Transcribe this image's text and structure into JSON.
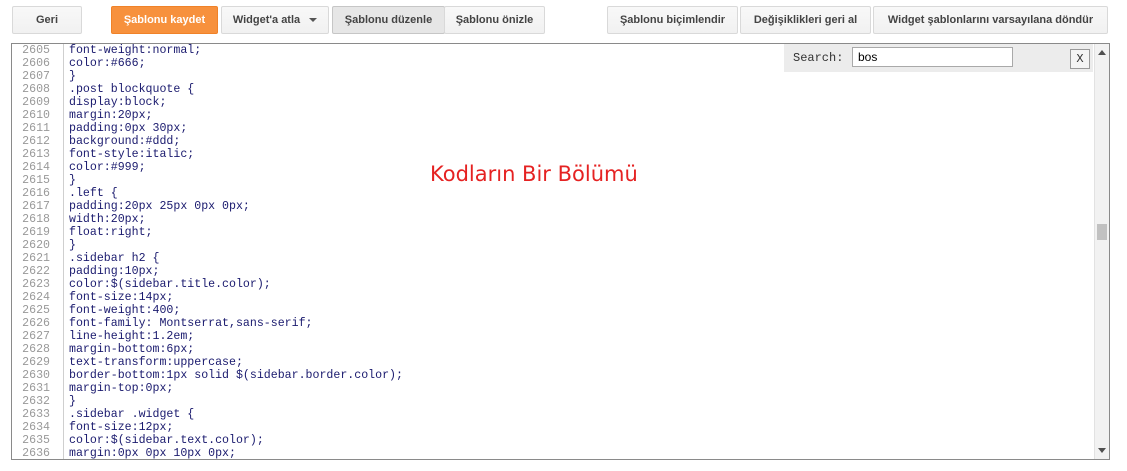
{
  "toolbar": {
    "back": "Geri",
    "save": "Şablonu kaydet",
    "jump_widget": "Widget'a atla",
    "edit_template": "Şablonu düzenle",
    "preview_template": "Şablonu önizle",
    "format_template": "Şablonu biçimlendir",
    "revert_changes": "Değişiklikleri geri al",
    "reset_widgets": "Widget şablonlarını varsayılana döndür"
  },
  "search": {
    "label": "Search:",
    "value": "bos",
    "close": "X"
  },
  "overlay_text": "Kodların Bir Bölümü",
  "code_lines": [
    {
      "n": "2605",
      "t": "font-weight:normal;"
    },
    {
      "n": "2606",
      "t": "color:#666;"
    },
    {
      "n": "2607",
      "t": "}"
    },
    {
      "n": "2608",
      "t": ".post blockquote {"
    },
    {
      "n": "2609",
      "t": "display:block;"
    },
    {
      "n": "2610",
      "t": "margin:20px;"
    },
    {
      "n": "2611",
      "t": "padding:0px 30px;"
    },
    {
      "n": "2612",
      "t": "background:#ddd;"
    },
    {
      "n": "2613",
      "t": "font-style:italic;"
    },
    {
      "n": "2614",
      "t": "color:#999;"
    },
    {
      "n": "2615",
      "t": "}"
    },
    {
      "n": "2616",
      "t": ".left {"
    },
    {
      "n": "2617",
      "t": "padding:20px 25px 0px 0px;"
    },
    {
      "n": "2618",
      "t": "width:20px;"
    },
    {
      "n": "2619",
      "t": "float:right;"
    },
    {
      "n": "2620",
      "t": "}"
    },
    {
      "n": "2621",
      "t": ".sidebar h2 {"
    },
    {
      "n": "2622",
      "t": "padding:10px;"
    },
    {
      "n": "2623",
      "t": "color:$(sidebar.title.color);"
    },
    {
      "n": "2624",
      "t": "font-size:14px;"
    },
    {
      "n": "2625",
      "t": "font-weight:400;"
    },
    {
      "n": "2626",
      "t": "font-family: Montserrat,sans-serif;"
    },
    {
      "n": "2627",
      "t": "line-height:1.2em;"
    },
    {
      "n": "2628",
      "t": "margin-bottom:6px;"
    },
    {
      "n": "2629",
      "t": "text-transform:uppercase;"
    },
    {
      "n": "2630",
      "t": "border-bottom:1px solid $(sidebar.border.color);"
    },
    {
      "n": "2631",
      "t": "margin-top:0px;"
    },
    {
      "n": "2632",
      "t": "}"
    },
    {
      "n": "2633",
      "t": ".sidebar .widget {"
    },
    {
      "n": "2634",
      "t": "font-size:12px;"
    },
    {
      "n": "2635",
      "t": "color:$(sidebar.text.color);"
    },
    {
      "n": "2636",
      "t": "margin:0px 0px 10px 0px;"
    }
  ]
}
